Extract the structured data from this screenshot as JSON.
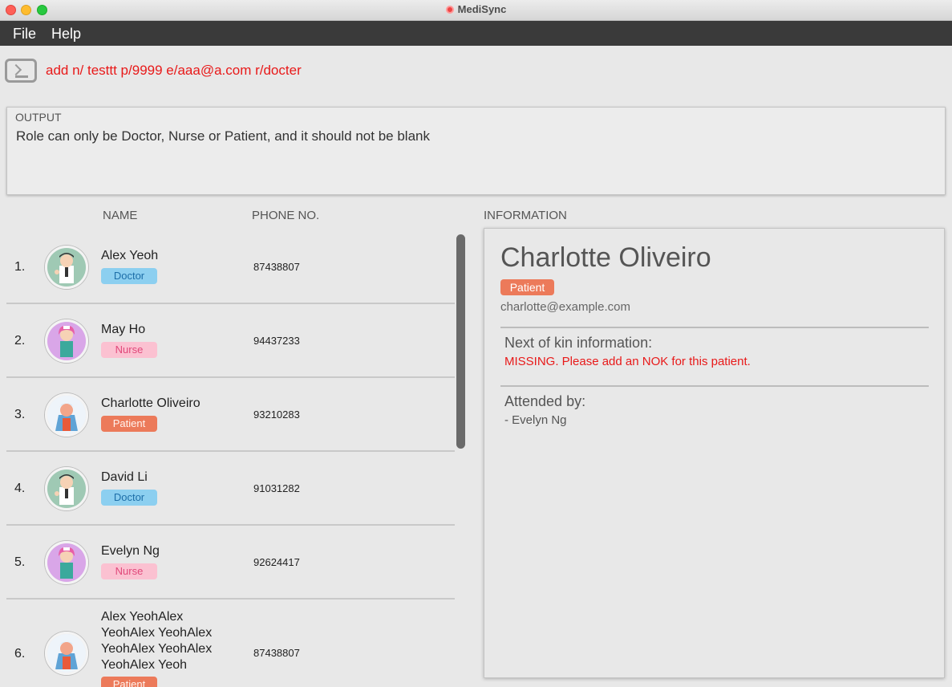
{
  "window": {
    "title": "MediSync"
  },
  "menu": {
    "file": "File",
    "help": "Help"
  },
  "command": {
    "value": "add n/ testtt p/9999 e/aaa@a.com r/docter"
  },
  "output": {
    "label": "OUTPUT",
    "message": "Role can only be Doctor, Nurse or Patient, and it should not be blank"
  },
  "list": {
    "headers": {
      "name": "NAME",
      "phone": "PHONE NO.",
      "info": "INFORMATION"
    },
    "persons": [
      {
        "index": "1.",
        "name": "Alex Yeoh",
        "role": "Doctor",
        "phone": "87438807"
      },
      {
        "index": "2.",
        "name": "May Ho",
        "role": "Nurse",
        "phone": "94437233"
      },
      {
        "index": "3.",
        "name": "Charlotte Oliveiro",
        "role": "Patient",
        "phone": "93210283"
      },
      {
        "index": "4.",
        "name": "David Li",
        "role": "Doctor",
        "phone": "91031282"
      },
      {
        "index": "5.",
        "name": "Evelyn Ng",
        "role": "Nurse",
        "phone": "92624417"
      },
      {
        "index": "6.",
        "name_lines": [
          "Alex YeohAlex",
          "YeohAlex YeohAlex",
          "YeohAlex YeohAlex",
          "YeohAlex Yeoh"
        ],
        "role": "Patient",
        "phone": "87438807"
      }
    ]
  },
  "info": {
    "name": "Charlotte Oliveiro",
    "role": "Patient",
    "email": "charlotte@example.com",
    "nok_heading": "Next of kin information:",
    "nok_value": "MISSING. Please add an NOK for this patient.",
    "attended_heading": "Attended by:",
    "attended_value": "- Evelyn Ng"
  },
  "colors": {
    "doctor": "#8ccff0",
    "nurse": "#fbc1d1",
    "patient": "#ec7a5a",
    "error": "#e81919"
  }
}
